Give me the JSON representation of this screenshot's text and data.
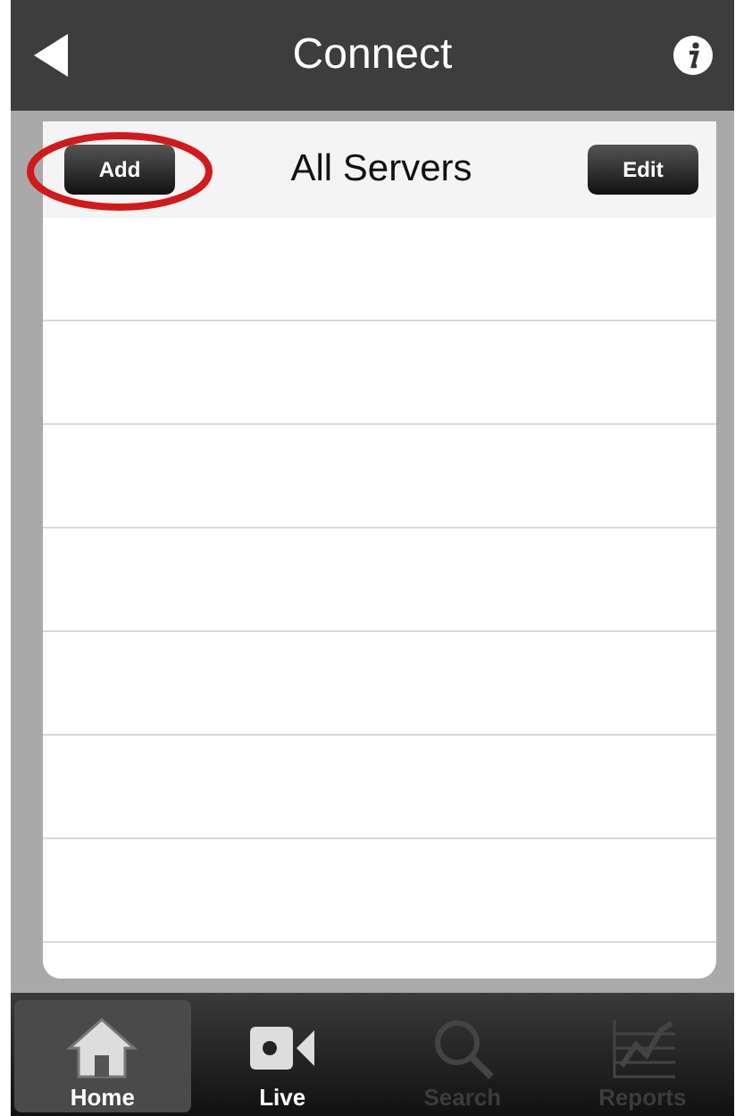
{
  "nav_bar": {
    "title": "Connect"
  },
  "list_header": {
    "title": "All Servers",
    "left_button": "Add",
    "right_button": "Edit"
  },
  "tabs": [
    {
      "label": "Home",
      "selected": true,
      "disabled": false
    },
    {
      "label": "Live",
      "selected": false,
      "disabled": false
    },
    {
      "label": "Search",
      "selected": false,
      "disabled": true
    },
    {
      "label": "Reports",
      "selected": false,
      "disabled": true
    }
  ]
}
